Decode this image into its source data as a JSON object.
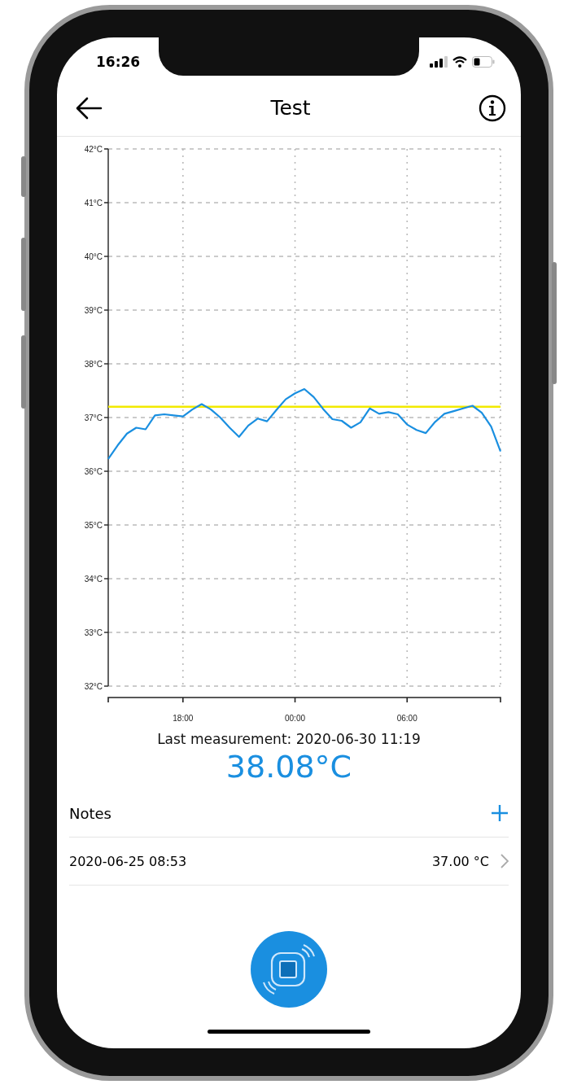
{
  "status_bar": {
    "time": "16:26"
  },
  "header": {
    "title": "Test"
  },
  "chart_data": {
    "type": "line",
    "grid": true,
    "ylim": [
      32,
      42
    ],
    "yticks": [
      {
        "value": 32,
        "label": "32°C"
      },
      {
        "value": 33,
        "label": "33°C"
      },
      {
        "value": 34,
        "label": "34°C"
      },
      {
        "value": 35,
        "label": "35°C"
      },
      {
        "value": 36,
        "label": "36°C"
      },
      {
        "value": 37,
        "label": "37°C"
      },
      {
        "value": 38,
        "label": "38°C"
      },
      {
        "value": 39,
        "label": "39°C"
      },
      {
        "value": 40,
        "label": "40°C"
      },
      {
        "value": 41,
        "label": "41°C"
      },
      {
        "value": 42,
        "label": "42°C"
      }
    ],
    "categories": [
      null,
      null,
      null,
      null,
      null,
      null,
      null,
      null,
      "18:00",
      null,
      null,
      null,
      null,
      null,
      null,
      null,
      null,
      null,
      null,
      null,
      "00:00",
      null,
      null,
      null,
      null,
      null,
      null,
      null,
      null,
      null,
      null,
      null,
      "06:00",
      null,
      null,
      null,
      null,
      null,
      null,
      null,
      null,
      null,
      null
    ],
    "series": [
      {
        "color": "#1a8fe0",
        "values": [
          36.23,
          36.48,
          36.7,
          36.81,
          36.78,
          37.04,
          37.06,
          37.04,
          37.02,
          37.15,
          37.25,
          37.15,
          37.0,
          36.81,
          36.64,
          36.85,
          36.98,
          36.93,
          37.14,
          37.34,
          37.45,
          37.53,
          37.38,
          37.16,
          36.97,
          36.94,
          36.81,
          36.91,
          37.17,
          37.07,
          37.1,
          37.06,
          36.87,
          36.77,
          36.71,
          36.92,
          37.07,
          37.12,
          37.17,
          37.22,
          37.09,
          36.83,
          36.37
        ]
      }
    ],
    "ref_lines": [
      {
        "axis": "y",
        "value": 37.2
      }
    ]
  },
  "last_measurement": {
    "label": "Last measurement: 2020-06-30 11:19",
    "value": "38.08°C"
  },
  "notes": {
    "title": "Notes",
    "items": [
      {
        "date": "2020-06-25 08:53",
        "value": "37.00 °C"
      }
    ]
  }
}
